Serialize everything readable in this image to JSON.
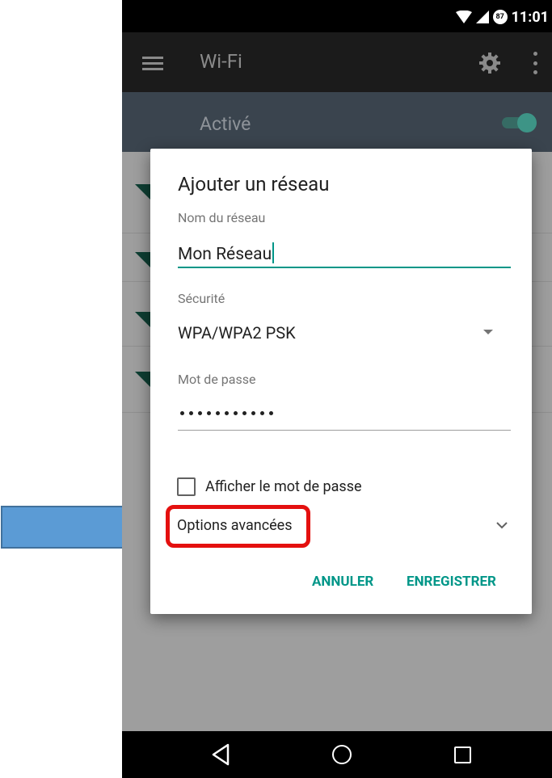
{
  "status_bar": {
    "time": "11:01",
    "battery": "87"
  },
  "app_bar": {
    "title": "Wi-Fi"
  },
  "toggle": {
    "label": "Activé",
    "state": "on"
  },
  "dialog": {
    "title": "Ajouter un réseau",
    "network_name_label": "Nom du réseau",
    "network_name_value": "Mon Réseau",
    "security_label": "Sécurité",
    "security_value": "WPA/WPA2 PSK",
    "password_label": "Mot de passe",
    "password_dot_count": 11,
    "show_password_label": "Afficher le mot de passe",
    "show_password_checked": false,
    "advanced_options_label": "Options avancées",
    "cancel_label": "ANNULER",
    "save_label": "ENREGISTRER"
  },
  "colors": {
    "accent": "#009688",
    "highlight": "#e4100f",
    "arrow": "#5b9bd5"
  },
  "icons": [
    "wifi-signal-icon",
    "signal-icon",
    "battery-icon",
    "menu-icon",
    "gear-icon",
    "more-vert-icon",
    "dropdown-arrow-icon",
    "chevron-down-icon",
    "back-icon",
    "home-icon",
    "recents-icon"
  ]
}
